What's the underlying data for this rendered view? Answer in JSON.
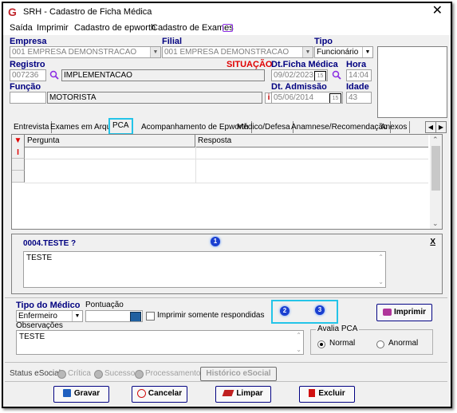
{
  "window": {
    "title": "SRH - Cadastro de Ficha Médica",
    "close_glyph": "✕",
    "icon_glyph": "G"
  },
  "menu": {
    "items": [
      "Saída",
      "Imprimir",
      "Cadastro de epworth",
      "Cadastro de Exames"
    ]
  },
  "header": {
    "empresa_label": "Empresa",
    "empresa_value": "001 EMPRESA DEMONSTRACAO",
    "filial_label": "Filial",
    "filial_value": "001 EMPRESA DEMONSTRACAO",
    "tipo_label": "Tipo",
    "tipo_value": "Funcionário",
    "registro_label": "Registro",
    "registro_value": "007236",
    "nome_value": "IMPLEMENTACAO",
    "situacao_label": "SITUAÇÃO",
    "dt_ficha_label": "Dt.Ficha Médica",
    "dt_ficha_value": "09/02/2023",
    "hora_label": "Hora",
    "hora_value": "14:04",
    "funcao_label": "Função",
    "funcao_code": "",
    "funcao_value": "MOTORISTA",
    "info_glyph": "i",
    "dt_admissao_label": "Dt. Admissão",
    "dt_admissao_value": "05/06/2014",
    "idade_label": "Idade",
    "idade_value": "43",
    "cal_glyph": "15"
  },
  "tabs": [
    "Entrevista",
    "Exames em Arquivo",
    "PCA",
    "Acompanhamento de Epworth",
    "Médico/Defesa",
    "Anamnese/Recomendação",
    "Anexos"
  ],
  "tab_scroll": {
    "left": "◀",
    "right": "▶"
  },
  "grid": {
    "columns": [
      "Pergunta",
      "Resposta"
    ],
    "indicator_glyph": "I"
  },
  "question_panel": {
    "title": "0004.TESTE ?",
    "close": "X",
    "answer": "TESTE"
  },
  "badges": [
    "1",
    "2",
    "3"
  ],
  "bottom": {
    "tipo_medico_label": "Tipo do Médico",
    "tipo_medico_value": "Enfermeiro",
    "pontuacao_label": "Pontuação",
    "pontuacao_value": "",
    "imprimir_respondidas_label": "Imprimir somente respondidas",
    "imprimir_button": "Imprimir",
    "observacoes_label": "Observações",
    "observacoes_value": "TESTE",
    "avalia_label": "Avalia PCA",
    "normal_label": "Normal",
    "anormal_label": "Anormal",
    "selected": "Normal"
  },
  "status": {
    "label": "Status eSocial:",
    "critica": "Crítica",
    "sucesso": "Sucesso",
    "processamento": "Processamento",
    "historico_button": "Histórico eSocial"
  },
  "actions": {
    "gravar": "Gravar",
    "cancelar": "Cancelar",
    "limpar": "Limpar",
    "excluir": "Excluir"
  },
  "colors": {
    "accent_highlight": "#24c4e8",
    "label_blue": "#000080",
    "situacao_red": "#e00000",
    "badge_blue": "#1a3fd0"
  }
}
